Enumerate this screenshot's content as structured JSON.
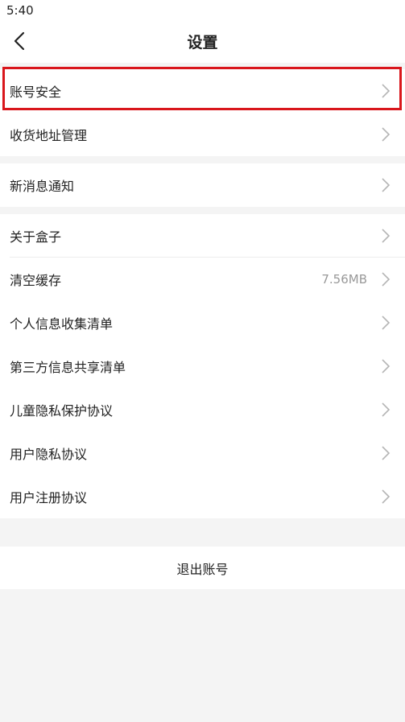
{
  "status_bar": {
    "time": "5:40"
  },
  "navbar": {
    "title": "设置",
    "back_icon": "chevron-left-icon"
  },
  "groups": [
    {
      "items": [
        {
          "label": "账号安全"
        },
        {
          "label": "收货地址管理"
        }
      ]
    },
    {
      "items": [
        {
          "label": "新消息通知"
        }
      ]
    },
    {
      "items": [
        {
          "label": "关于盒子"
        },
        {
          "label": "清空缓存",
          "value": "7.56MB"
        },
        {
          "label": "个人信息收集清单"
        },
        {
          "label": "第三方信息共享清单"
        },
        {
          "label": "儿童隐私保护协议"
        },
        {
          "label": "用户隐私协议"
        },
        {
          "label": "用户注册协议"
        }
      ]
    }
  ],
  "logout": {
    "label": "退出账号"
  },
  "colors": {
    "highlight": "#d9161c",
    "background": "#f4f4f4",
    "chevron": "#b5b5b5"
  }
}
